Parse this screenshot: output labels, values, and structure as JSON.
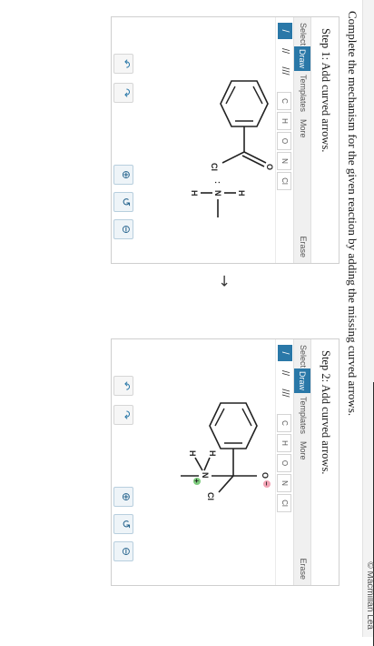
{
  "header": {
    "copyright": "© Macmillan Lea"
  },
  "question": "Complete the mechanism for the given reaction by adding the missing curved arrows.",
  "panels": [
    {
      "step_title": "Step 1: Add curved arrows.",
      "tabs": {
        "select": "Select",
        "draw": "Draw",
        "templates": "Templates",
        "more": "More",
        "erase": "Erase"
      },
      "bond_tools": [
        "/",
        "//",
        "///"
      ],
      "atoms": [
        "C",
        "H",
        "O",
        "N",
        "Cl"
      ],
      "molecule": {
        "o_label": "O",
        "cl_label": "Cl",
        "n_label": "N",
        "h_label": "H",
        "lone_pair": ":"
      }
    },
    {
      "step_title": "Step 2: Add curved arrows.",
      "tabs": {
        "select": "Select",
        "draw": "Draw",
        "templates": "Templates",
        "more": "More",
        "erase": "Erase"
      },
      "bond_tools": [
        "/",
        "//",
        "///"
      ],
      "atoms": [
        "C",
        "H",
        "O",
        "N",
        "Cl"
      ],
      "molecule": {
        "o_label": "O",
        "cl_label": "Cl",
        "n_label": "N",
        "h_label": "H",
        "plus": "+",
        "minus": "−"
      }
    }
  ],
  "arrow_between": "→",
  "icons": [
    "undo-icon",
    "redo-icon",
    "zoom-in-icon",
    "zoom-reset-icon",
    "zoom-out-icon"
  ]
}
